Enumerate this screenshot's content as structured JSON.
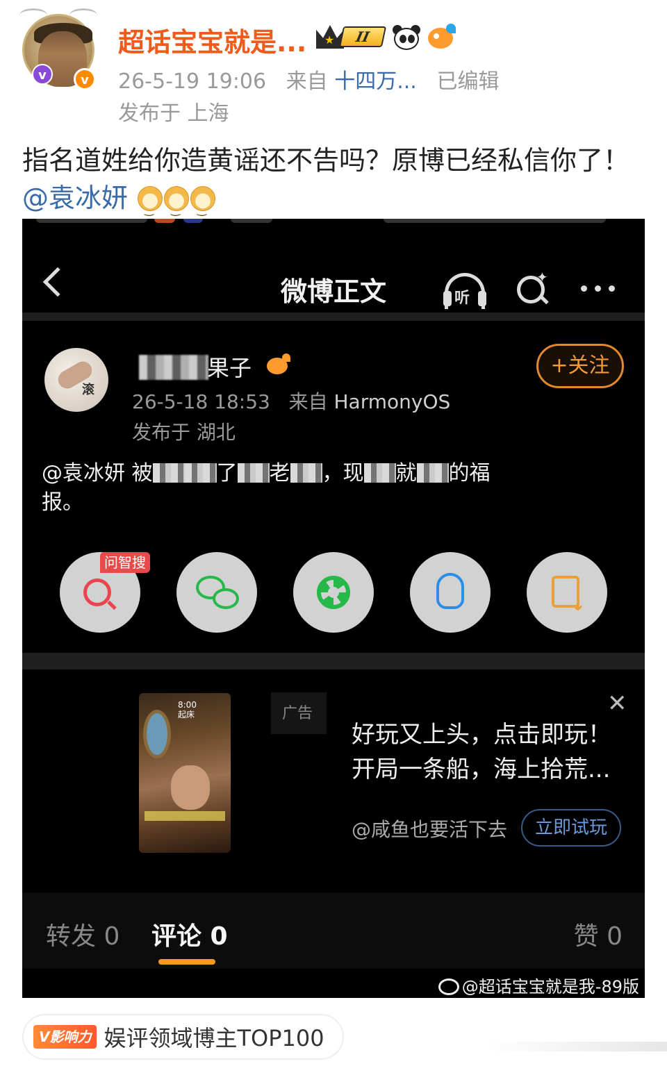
{
  "author": {
    "name": "超话宝宝就是...",
    "rank_badge": "II",
    "timestamp": "26-5-19 19:06",
    "source_prefix": "来自",
    "source": "十四万...",
    "edited": "已编辑",
    "location": "发布于 上海",
    "icons": [
      "crown-rank-badge",
      "panda-icon",
      "fish-icon",
      "verified-v-icon"
    ]
  },
  "post": {
    "text": "指名道姓给你造黄谣还不告吗？原博已经私信你了！",
    "mention": "@袁冰妍"
  },
  "screenshot": {
    "title": "微博正文",
    "listen_label": "听",
    "inner_post": {
      "name_suffix": "果子",
      "avatar_char": "滚",
      "follow_label": "+关注",
      "timestamp": "26-5-18 18:53",
      "source_prefix": "来自",
      "source": "HarmonyOS",
      "location": "发布于 湖北",
      "text_start": "@袁冰妍 被",
      "text_mid_1": "了",
      "text_mid_2": "老",
      "text_mid_3": "，现",
      "text_mid_4": "就",
      "text_mid_5": "的福",
      "text_end": "报。"
    },
    "share": {
      "tag": "问智搜",
      "icons": [
        "ai-search-icon",
        "wechat-icon",
        "moments-icon",
        "qq-icon",
        "save-image-icon"
      ]
    },
    "ad": {
      "label": "广告",
      "image_time": "8:00",
      "image_sub": "起床",
      "line1": "好玩又上头，点击即玩！",
      "line2": "开局一条船，海上拾荒...",
      "account": "@咸鱼也要活下去",
      "button": "立即试玩"
    },
    "tabs": {
      "repost": "转发 0",
      "comment": "评论 0",
      "like": "赞 0"
    },
    "watermark": "@超话宝宝就是我-89版"
  },
  "influence": {
    "tag": "V影响力",
    "text": "娱评领域博主TOP100"
  },
  "colors": {
    "name_orange": "#f05a1a",
    "link_blue": "#3a6aa8",
    "follow_orange": "#e28a2b",
    "tab_underline": "#f29a1a"
  }
}
